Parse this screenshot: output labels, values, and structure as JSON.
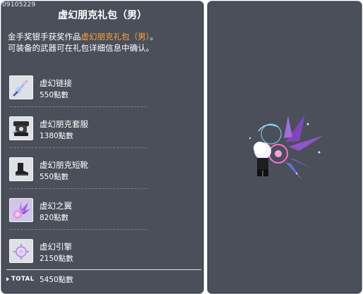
{
  "item_id": "09105229",
  "title": "虚幻朋克礼包（男）",
  "description": {
    "line1_prefix": "金手奖银手获奖作品",
    "line1_highlight": "虚幻朋克礼包（男）",
    "line1_suffix": "。",
    "line2": "可装备的武器可在礼包详细信息中确认。"
  },
  "colors": {
    "highlight": "#ffa13a",
    "panel_bg": "#4a4f5a",
    "panel_border": "#8d93a0"
  },
  "items": [
    {
      "name": "虚幻链接",
      "price": "550點數",
      "icon": "phantom-link-icon"
    },
    {
      "name": "虚幻朋克套服",
      "price": "1380點數",
      "icon": "punk-outfit-icon"
    },
    {
      "name": "虚幻朋克短靴",
      "price": "550點數",
      "icon": "short-boots-icon"
    },
    {
      "name": "虚幻之翼",
      "price": "820點數",
      "icon": "phantom-wings-icon"
    },
    {
      "name": "虚幻引擎",
      "price": "2150點數",
      "icon": "phantom-engine-icon"
    }
  ],
  "total": {
    "label": "TOTAL",
    "value": "5450點數"
  }
}
